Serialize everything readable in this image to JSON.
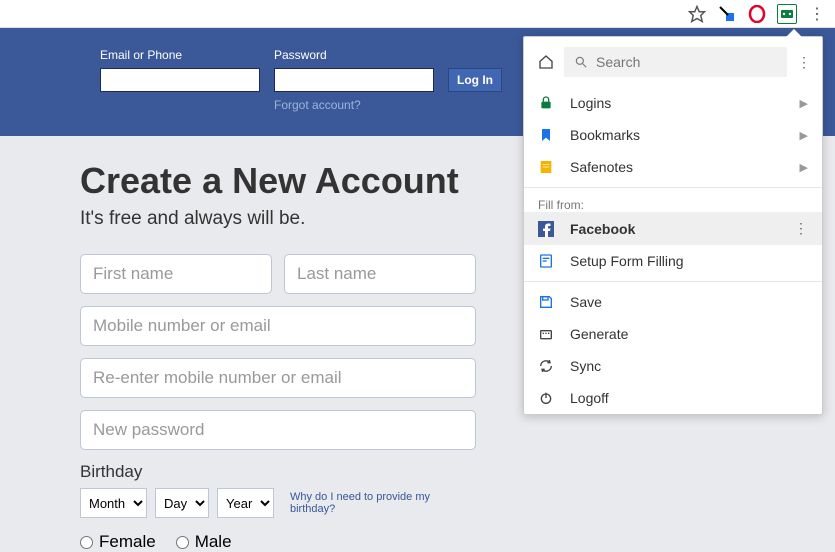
{
  "header": {
    "email_label": "Email or Phone",
    "password_label": "Password",
    "login_label": "Log In",
    "forgot_label": "Forgot account?"
  },
  "signup": {
    "title": "Create a New Account",
    "subtitle": "It's free and always will be.",
    "first_name_ph": "First name",
    "last_name_ph": "Last name",
    "mobile_ph": "Mobile number or email",
    "reenter_ph": "Re-enter mobile number or email",
    "password_ph": "New password",
    "birthday_label": "Birthday",
    "month_label": "Month",
    "day_label": "Day",
    "year_label": "Year",
    "why_text": "Why do I need to provide my birthday?",
    "female_label": "Female",
    "male_label": "Male"
  },
  "popup": {
    "search_ph": "Search",
    "logins": "Logins",
    "bookmarks": "Bookmarks",
    "safenotes": "Safenotes",
    "fill_from": "Fill from:",
    "facebook": "Facebook",
    "setup_ff": "Setup Form Filling",
    "save": "Save",
    "generate": "Generate",
    "sync": "Sync",
    "logoff": "Logoff"
  }
}
